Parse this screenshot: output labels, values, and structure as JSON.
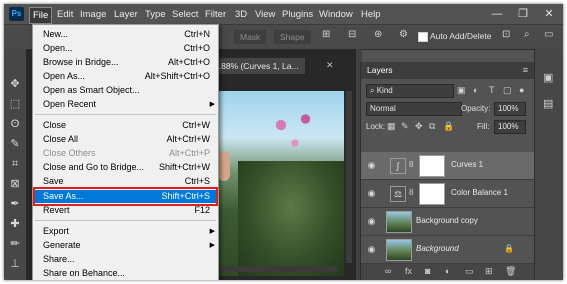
{
  "app": {
    "logo_text": "Ps"
  },
  "menubar": {
    "items": [
      "File",
      "Edit",
      "Image",
      "Layer",
      "Type",
      "Select",
      "Filter",
      "3D",
      "View",
      "Plugins",
      "Window",
      "Help"
    ],
    "active": "File",
    "window_controls": {
      "minimize": "—",
      "restore": "❐",
      "close": "✕"
    }
  },
  "options_bar": {
    "mask_label": "Mask",
    "shape_label": "Shape",
    "auto_add_delete_label": "Auto Add/Delete"
  },
  "document": {
    "tab_title": "5.88% (Curves 1, La...",
    "tab_close": "✕"
  },
  "file_menu": {
    "items": [
      {
        "label": "New...",
        "shortcut": "Ctrl+N"
      },
      {
        "label": "Open...",
        "shortcut": "Ctrl+O"
      },
      {
        "label": "Browse in Bridge...",
        "shortcut": "Alt+Ctrl+O"
      },
      {
        "label": "Open As...",
        "shortcut": "Alt+Shift+Ctrl+O"
      },
      {
        "label": "Open as Smart Object...",
        "shortcut": ""
      },
      {
        "label": "Open Recent",
        "shortcut": "",
        "submenu": true
      },
      {
        "label": "Close",
        "shortcut": "Ctrl+W"
      },
      {
        "label": "Close All",
        "shortcut": "Alt+Ctrl+W"
      },
      {
        "label": "Close Others",
        "shortcut": "Alt+Ctrl+P",
        "disabled": true
      },
      {
        "label": "Close and Go to Bridge...",
        "shortcut": "Shift+Ctrl+W"
      },
      {
        "label": "Save",
        "shortcut": "Ctrl+S"
      },
      {
        "label": "Save As...",
        "shortcut": "Shift+Ctrl+S",
        "selected": true
      },
      {
        "label": "Revert",
        "shortcut": "F12"
      },
      {
        "label": "Export",
        "shortcut": "",
        "submenu": true
      },
      {
        "label": "Generate",
        "shortcut": "",
        "submenu": true
      },
      {
        "label": "Share...",
        "shortcut": ""
      },
      {
        "label": "Share on Behance...",
        "shortcut": ""
      }
    ]
  },
  "layers_panel": {
    "title": "Layers",
    "filter_kind": "Kind",
    "blend_mode": "Normal",
    "opacity_label": "Opacity:",
    "opacity_value": "100%",
    "lock_label": "Lock:",
    "fill_label": "Fill:",
    "fill_value": "100%",
    "layers": [
      {
        "name": "Curves 1",
        "type": "adjustment",
        "selected": true
      },
      {
        "name": "Color Balance 1",
        "type": "adjustment",
        "selected": false
      },
      {
        "name": "Background copy",
        "type": "image",
        "selected": false
      },
      {
        "name": "Background",
        "type": "image",
        "locked": true,
        "selected": false
      }
    ]
  },
  "colors": {
    "selection": "#0078d7",
    "highlight_border": "#e0201b",
    "app_bg": "#535353"
  }
}
